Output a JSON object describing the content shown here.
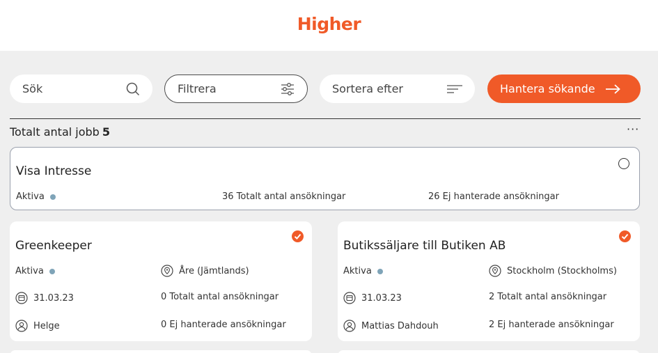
{
  "header": {
    "logo": "Higher"
  },
  "toolbar": {
    "search_placeholder": "Sök",
    "filter_label": "Filtrera",
    "sort_label": "Sortera efter",
    "manage_label": "Hantera sökande"
  },
  "summary": {
    "label": "Totalt antal jobb",
    "count": "5",
    "more": "···"
  },
  "jobs": [
    {
      "title": "Visa Intresse",
      "status": "Aktiva",
      "total_applications": "36 Totalt antal ansökningar",
      "unhandled_applications": "26 Ej hanterade ansökningar",
      "selected": false
    },
    {
      "title": "Greenkeeper",
      "status": "Aktiva",
      "location": "Åre (Jämtlands)",
      "date": "31.03.23",
      "total_applications": "0 Totalt antal ansökningar",
      "owner": "Helge",
      "unhandled_applications": "0 Ej hanterade ansökningar",
      "selected": true
    },
    {
      "title": "Butikssäljare till Butiken AB",
      "status": "Aktiva",
      "location": "Stockholm (Stockholms)",
      "date": "31.03.23",
      "total_applications": "2 Totalt antal ansökningar",
      "owner": "Mattias Dahdouh",
      "unhandled_applications": "2 Ej hanterade ansökningar",
      "selected": true
    }
  ],
  "colors": {
    "brand": "#f05a28",
    "status_dot": "#7fa4b8"
  }
}
